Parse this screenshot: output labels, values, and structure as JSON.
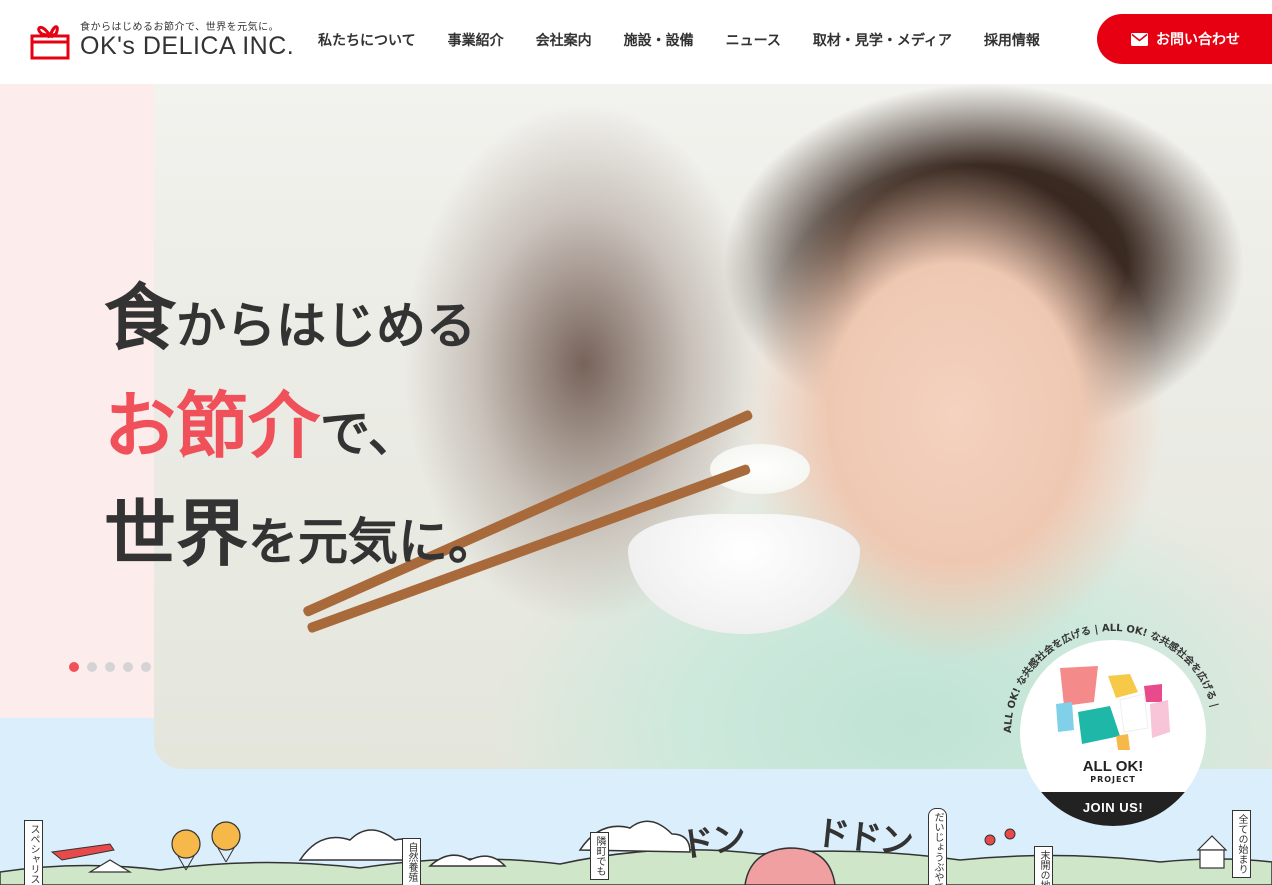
{
  "header": {
    "logo_tagline": "食からはじめるお節介で、世界を元気に。",
    "logo_name": "OK's DELICA INC.",
    "nav": [
      {
        "label": "私たちについて"
      },
      {
        "label": "事業紹介"
      },
      {
        "label": "会社案内"
      },
      {
        "label": "施設・設備"
      },
      {
        "label": "ニュース"
      },
      {
        "label": "取材・見学・メディア"
      },
      {
        "label": "採用情報"
      }
    ],
    "contact_label": "お問い合わせ"
  },
  "hero": {
    "line1_big": "食",
    "line1_rest": "からはじめる",
    "line2_accent": "お節介",
    "line2_rest": "で、",
    "line3_big": "世界",
    "line3_rest": "を元気に。",
    "slides_total": 5,
    "slide_active": 1
  },
  "badge": {
    "title": "ALL OK!",
    "subtitle": "PROJECT",
    "join": "JOIN US!",
    "ring_text": "ALL OK! な共感社会を広げる | ALL OK! な共感社会を広げる | "
  },
  "illustration": {
    "tags": [
      "スペシャリスト",
      "自然養殖",
      "隣町でも",
      "だいじょうぶやで～",
      "末開の地",
      "全ての始まり"
    ],
    "onomatopoeia": [
      "ドン",
      "ドドン"
    ]
  },
  "colors": {
    "accent": "#f0505a",
    "brand_red": "#e60012",
    "pink_bg": "#fdecec",
    "blue_band": "#dbeefb"
  }
}
